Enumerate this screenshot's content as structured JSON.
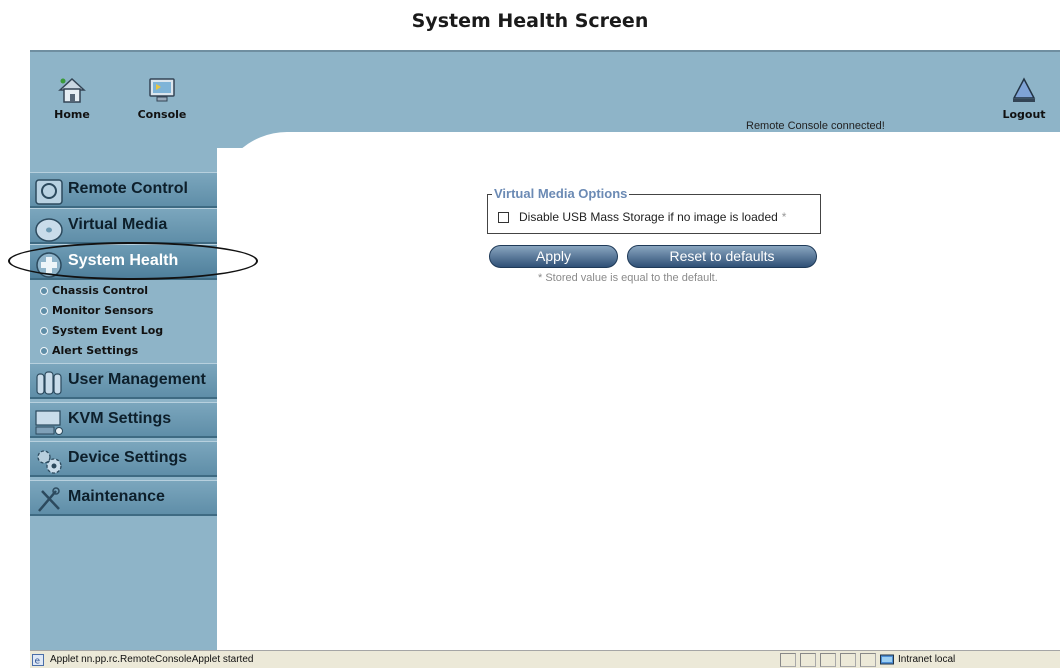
{
  "page_title": "System Health Screen",
  "toolbar": {
    "home_label": "Home",
    "console_label": "Console",
    "logout_label": "Logout",
    "status": "Remote Console connected!"
  },
  "sidebar": {
    "items": [
      {
        "label": "Remote Control",
        "icon": "monitor-icon"
      },
      {
        "label": "Virtual Media",
        "icon": "disc-icon"
      },
      {
        "label": "System Health",
        "icon": "health-cross-icon",
        "active": true
      },
      {
        "label": "User Management",
        "icon": "users-icon"
      },
      {
        "label": "KVM Settings",
        "icon": "kvm-icon"
      },
      {
        "label": "Device Settings",
        "icon": "gears-icon"
      },
      {
        "label": "Maintenance",
        "icon": "tools-icon"
      }
    ],
    "subitems": [
      {
        "label": "Chassis Control"
      },
      {
        "label": "Monitor Sensors"
      },
      {
        "label": "System Event Log"
      },
      {
        "label": "Alert Settings"
      }
    ]
  },
  "options": {
    "legend": "Virtual Media Options",
    "checkbox_label": "Disable USB Mass Storage if no image is loaded",
    "checkbox_checked": false,
    "default_marker": "*",
    "apply_label": "Apply",
    "reset_label": "Reset to defaults",
    "footnote": "* Stored value is equal to the default."
  },
  "statusbar": {
    "text": "Applet nn.pp.rc.RemoteConsoleApplet started",
    "zone": "Intranet local"
  },
  "colors": {
    "sidebar_bg": "#8eb4c8",
    "menu_button": "#6d9ab3",
    "legend_text": "#6b8ab4",
    "pill_button": "#3d5f86"
  }
}
